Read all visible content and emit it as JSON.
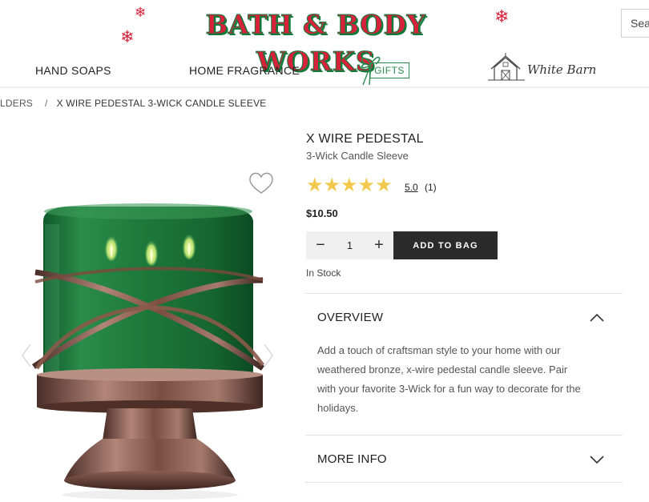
{
  "header": {
    "logo_text": "BATH & BODY WORKS",
    "search_placeholder": "Sear",
    "nav": [
      {
        "label": "HAND SOAPS"
      },
      {
        "label": "HOME FRAGRANCE"
      },
      {
        "label": "GIFTS"
      },
      {
        "label": "White Barn"
      }
    ]
  },
  "breadcrumb": {
    "parent": "LDERS",
    "separator": "/",
    "current": "X WIRE PEDESTAL 3-WICK CANDLE SLEEVE"
  },
  "product": {
    "title": "X WIRE PEDESTAL",
    "subtitle": "3-Wick Candle Sleeve",
    "stars_display": "★★★★★",
    "rating": "5.0",
    "review_count": "(1)",
    "price": "$10.50",
    "quantity": "1",
    "qty_minus": "−",
    "qty_plus": "+",
    "add_to_bag": "ADD TO BAG",
    "stock_status": "In Stock"
  },
  "accordion": {
    "overview_label": "OVERVIEW",
    "overview_text": "Add a touch of craftsman style to your home with our weathered bronze, x-wire pedestal candle sleeve. Pair with your favorite 3-Wick for a fun way to decorate for the holidays.",
    "more_info_label": "MORE INFO"
  },
  "colors": {
    "logo_red": "#d8213a",
    "logo_green": "#0f7a3a",
    "star": "#f2c94c",
    "button_dark": "#2b2b2b",
    "candle_green": "#1f7a3c",
    "bronze": "#8a5a4a"
  },
  "icons": [
    "snowflake-icon",
    "gift-bow-icon",
    "barn-icon",
    "heart-icon",
    "chevron-left-icon",
    "chevron-right-icon",
    "chevron-up-icon",
    "chevron-down-icon"
  ]
}
